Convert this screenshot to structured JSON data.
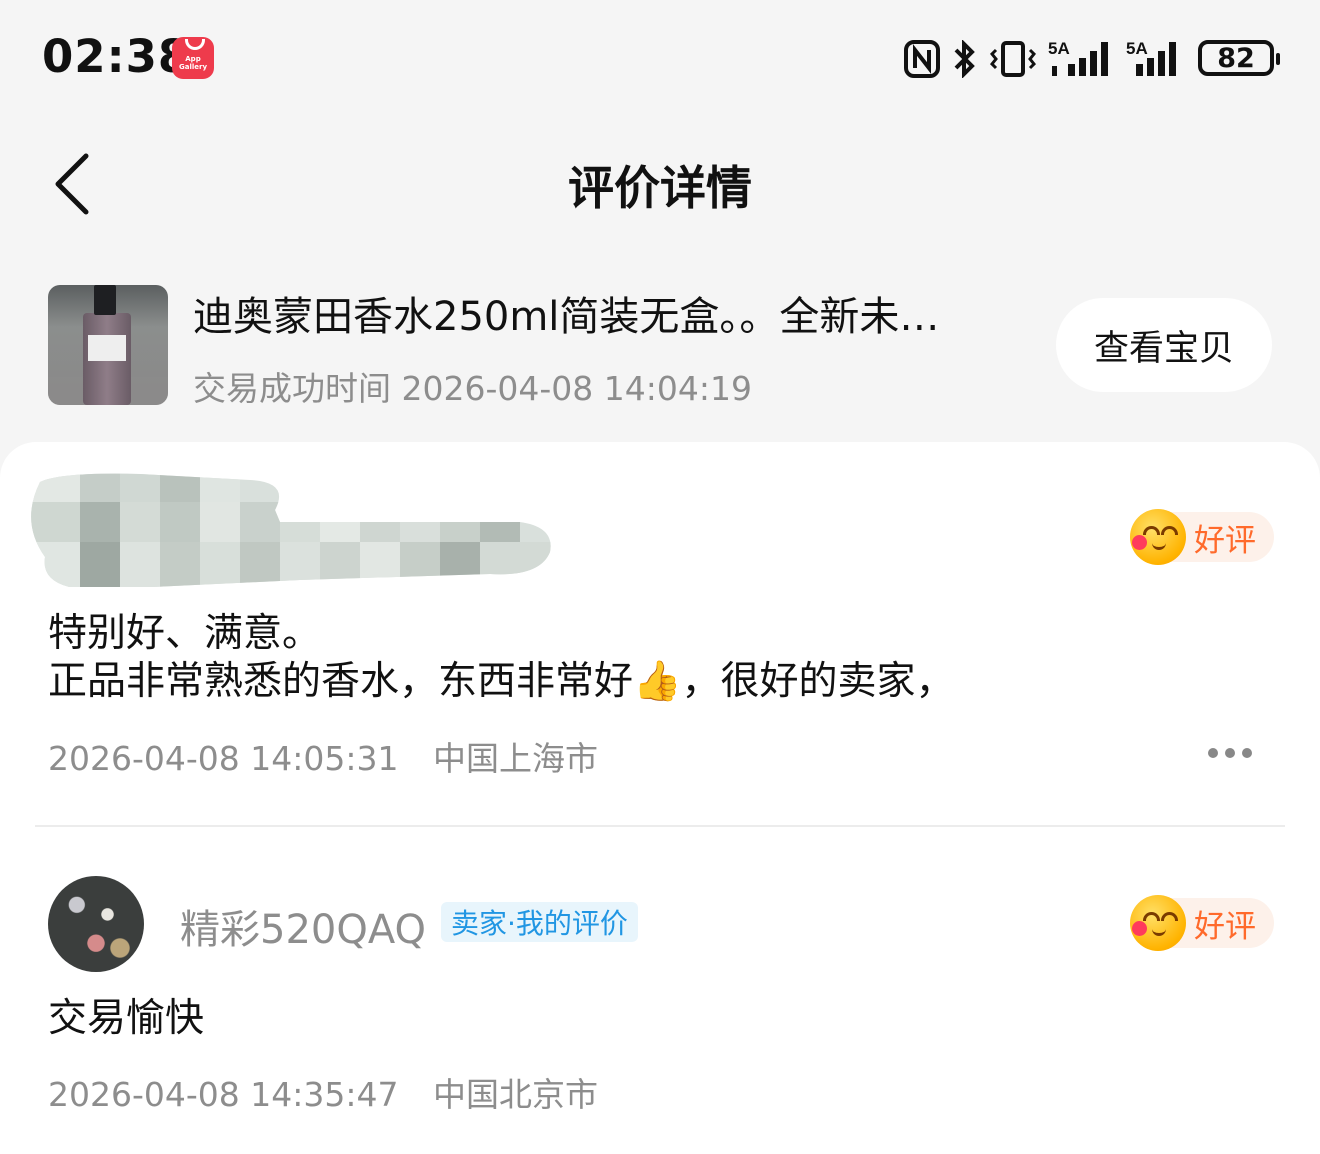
{
  "status_bar": {
    "time": "02:38",
    "app_icon_text": "App Gallery",
    "icons": [
      "nfc-icon",
      "bluetooth-icon",
      "vibrate-icon",
      "signal-5a-icon",
      "signal-5a-icon"
    ],
    "battery": "82"
  },
  "header": {
    "title": "评价详情"
  },
  "product": {
    "title": "迪奥蒙田香水250ml简装无盒。。全新未…",
    "time_label": "交易成功时间",
    "time_value": "2026-04-08 14:04:19",
    "view_button": "查看宝贝"
  },
  "reviews": [
    {
      "badge": "好评",
      "text_line1": "特别好、满意。",
      "text_line2": "正品非常熟悉的香水，东西非常好👍，很好的卖家，",
      "date": "2026-04-08 14:05:31",
      "location": "中国上海市"
    },
    {
      "name": "精彩520QAQ",
      "tag": "卖家·我的评价",
      "badge": "好评",
      "text": "交易愉快",
      "date": "2026-04-08 14:35:47",
      "location": "中国北京市"
    }
  ],
  "colors": {
    "background": "#f5f5f5",
    "badge_text": "#ff6a2b",
    "badge_bg": "#fdf1ea",
    "seller_tag_text": "#2196e3",
    "meta_text": "#8d8d8d"
  }
}
